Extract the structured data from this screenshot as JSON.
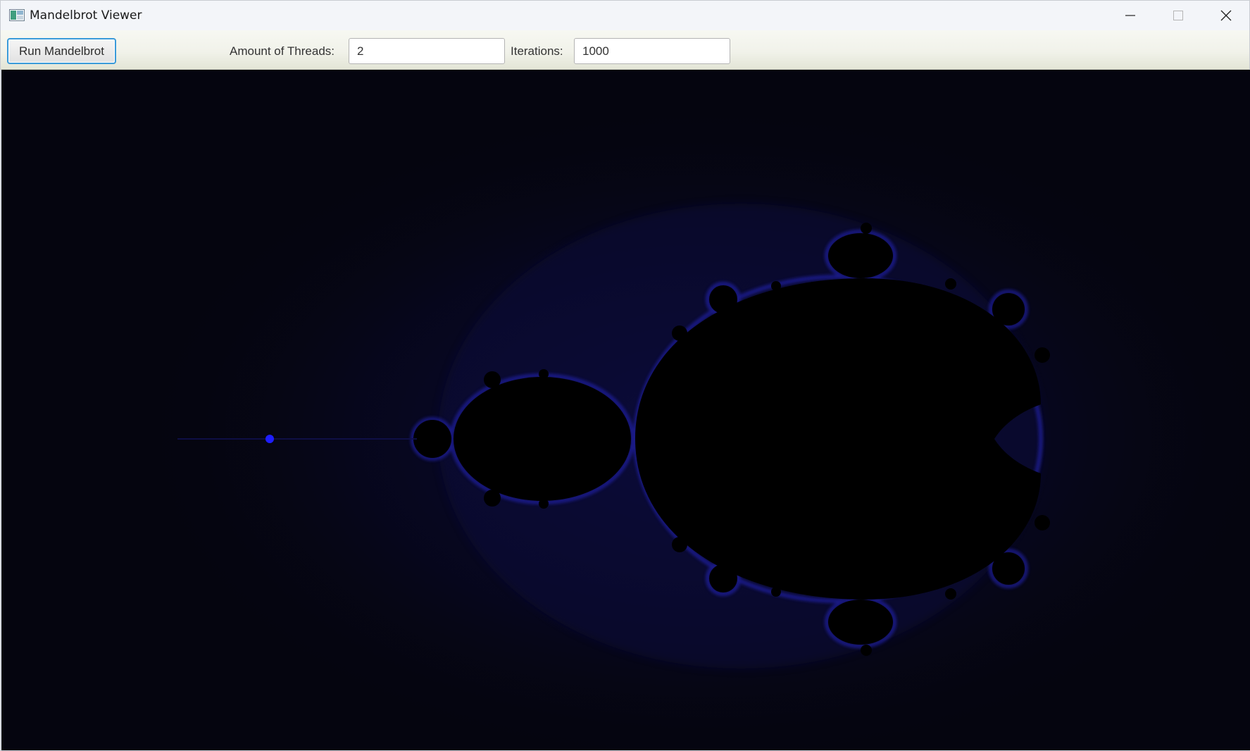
{
  "window": {
    "title": "Mandelbrot Viewer",
    "icon": "app-window-icon",
    "controls": {
      "minimize_icon": "minimize-icon",
      "maximize_icon": "maximize-icon",
      "close_icon": "close-icon"
    }
  },
  "toolbar": {
    "run_label": "Run Mandelbrot",
    "threads_label": "Amount of Threads:",
    "threads_value": "2",
    "iterations_label": "Iterations:",
    "iterations_value": "1000"
  },
  "render": {
    "description_colors": {
      "background": "#05050f",
      "set": "#000000",
      "glow": "#1a1aff",
      "accent_point": "#1e1eff"
    }
  }
}
